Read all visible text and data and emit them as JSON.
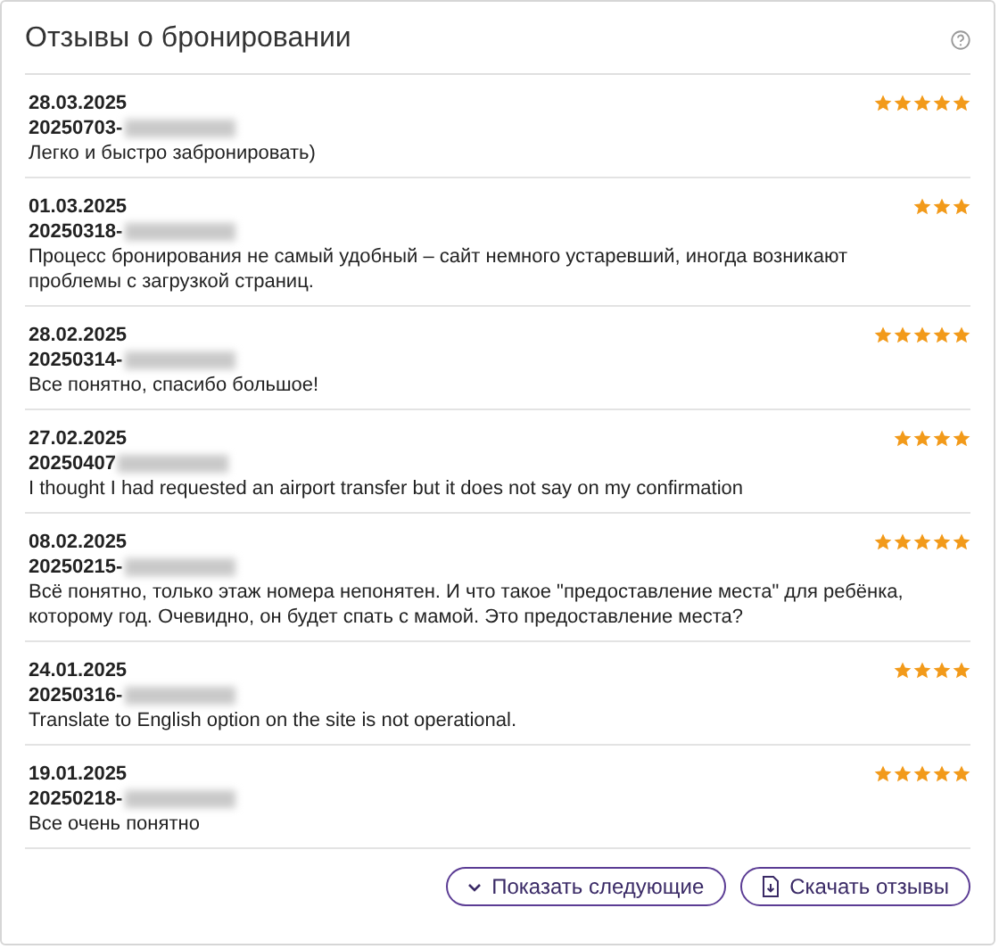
{
  "title": "Отзывы о бронировании",
  "reviews": [
    {
      "date": "28.03.2025",
      "booking": "20250703-",
      "stars": 5,
      "text": "Легко и быстро забронировать)"
    },
    {
      "date": "01.03.2025",
      "booking": "20250318-",
      "stars": 3,
      "text": "Процесс бронирования не самый удобный – сайт немного устаревший, иногда возникают проблемы с загрузкой страниц."
    },
    {
      "date": "28.02.2025",
      "booking": "20250314-",
      "stars": 5,
      "text": "Все понятно, спасибо большое!"
    },
    {
      "date": "27.02.2025",
      "booking": "20250407",
      "stars": 4,
      "text": "I thought I had requested an airport transfer but it does not say on my confirmation"
    },
    {
      "date": "08.02.2025",
      "booking": "20250215-",
      "stars": 5,
      "text": "Всё понятно, только этаж номера непонятен. И что такое \"предоставление места\" для ребёнка, которому год. Очевидно, он будет спать с мамой. Это предоставление места?"
    },
    {
      "date": "24.01.2025",
      "booking": "20250316-",
      "stars": 4,
      "text": "Translate to English option on the site is not operational."
    },
    {
      "date": "19.01.2025",
      "booking": "20250218-",
      "stars": 5,
      "text": "Все очень понятно"
    }
  ],
  "buttons": [
    {
      "kind": "more",
      "label": "Показать следующие"
    },
    {
      "kind": "download",
      "label": "Скачать отзывы"
    }
  ]
}
